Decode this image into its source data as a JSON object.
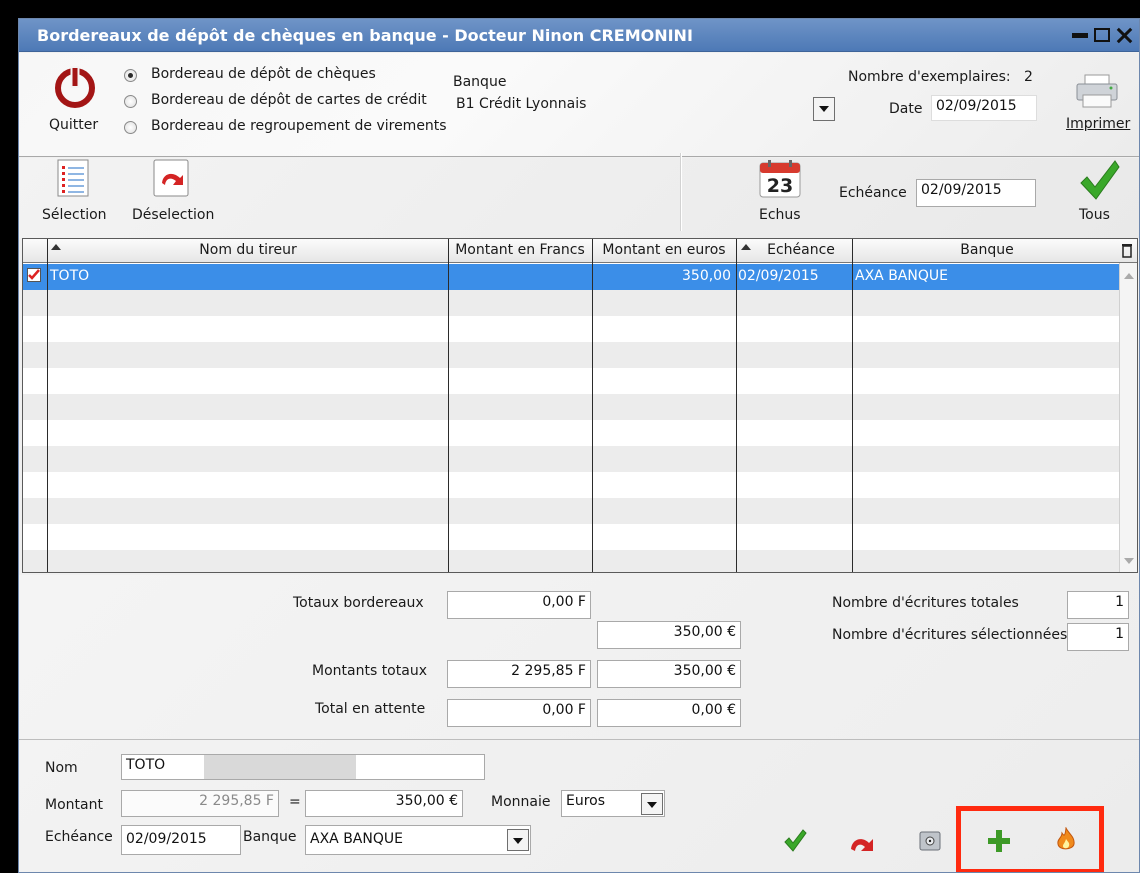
{
  "window": {
    "title": "Bordereaux de dépôt de chèques en banque - Docteur Ninon CREMONINI"
  },
  "top": {
    "quit_label": "Quitter",
    "radios": [
      {
        "label": "Bordereau de dépôt de chèques",
        "selected": true
      },
      {
        "label": "Bordereau de dépôt de cartes de crédit",
        "selected": false
      },
      {
        "label": "Bordereau de regroupement de virements",
        "selected": false
      }
    ],
    "bank_label": "Banque",
    "bank_value": "B1 Crédit Lyonnais",
    "copies_label": "Nombre d'exemplaires:",
    "copies_value": "2",
    "date_label": "Date",
    "date_value": "02/09/2015",
    "print_label": "Imprimer"
  },
  "toolbar": {
    "selection_label": "Sélection",
    "deselection_label": "Déselection",
    "calendar_day": "23",
    "echus_label": "Echus",
    "echeance_label": "Echéance",
    "echeance_value": "02/09/2015",
    "tous_label": "Tous"
  },
  "table": {
    "columns": [
      "Nom du tireur",
      "Montant en Francs",
      "Montant en euros",
      "Echéance",
      "Banque"
    ],
    "rows": [
      {
        "checked": true,
        "nom": "TOTO",
        "francs": "",
        "euros": "350,00",
        "echeance": "02/09/2015",
        "banque": "AXA BANQUE"
      }
    ]
  },
  "totals": {
    "totaux_label": "Totaux bordereaux",
    "totaux_francs": "0,00 F",
    "totaux_euros": "350,00 €",
    "montants_label": "Montants totaux",
    "montants_francs": "2 295,85 F",
    "montants_euros": "350,00 €",
    "attente_label": "Total en attente",
    "attente_francs": "0,00 F",
    "attente_euros": "0,00 €",
    "ecr_totales_label": "Nombre d'écritures totales",
    "ecr_totales_value": "1",
    "ecr_sel_label": "Nombre d'écritures sélectionnées",
    "ecr_sel_value": "1"
  },
  "form": {
    "nom_label": "Nom",
    "nom_value": "TOTO",
    "montant_label": "Montant",
    "montant_francs": "2 295,85 F",
    "equals": "=",
    "montant_euros": "350,00 €",
    "monnaie_label": "Monnaie",
    "monnaie_value": "Euros",
    "echeance_label": "Echéance",
    "echeance_value": "02/09/2015",
    "banque_label": "Banque",
    "banque_value": "AXA BANQUE"
  },
  "colors": {
    "title_bar": "#4d79b6",
    "selected_row": "#3b8ee8",
    "highlight_box": "#ff2a0f",
    "ok_green": "#3aa82a",
    "undo_red": "#d42424"
  }
}
